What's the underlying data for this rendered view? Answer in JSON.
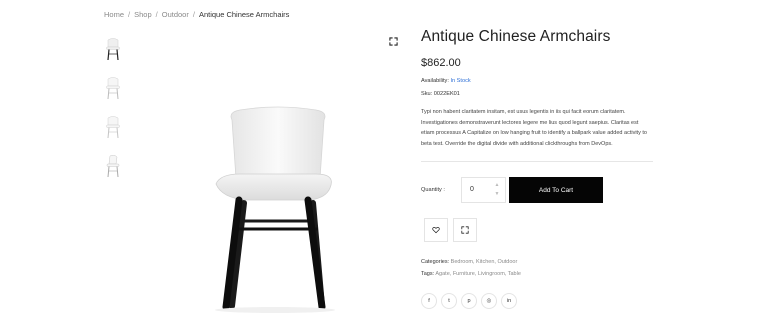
{
  "breadcrumb": {
    "items": [
      "Home",
      "Shop",
      "Outdoor"
    ],
    "separator": "/",
    "current": "Antique Chinese Armchairs"
  },
  "thumbnails": [
    {
      "icon": "chair-thumbnail-icon",
      "style": "dark legs"
    },
    {
      "icon": "chair-thumbnail-icon",
      "style": "light"
    },
    {
      "icon": "chair-thumbnail-icon",
      "style": "light"
    },
    {
      "icon": "chair-thumbnail-icon",
      "style": "light"
    }
  ],
  "product": {
    "title": "Antique Chinese Armchairs",
    "price": "$862.00",
    "availability_label": "Availability:",
    "availability_value": "In Stock",
    "sku_label": "Sku:",
    "sku_value": "0022EK01",
    "description": "Typi non habent claritatem insitam, est usus legentis in iis qui facit eorum claritatem. Investigationes demonstraverunt lectores legere me lius quod legunt saepius. Claritas est etiam processus A Capitalize on low hanging fruit to identify a ballpark value added activity to beta test. Override the digital divide with additional clickthroughs from DevOps."
  },
  "quantity": {
    "label": "Quantity :",
    "value": "0"
  },
  "cart": {
    "button_label": "Add To Cart"
  },
  "actions": {
    "wishlist_icon": "heart-icon",
    "compare_icon": "compare-icon"
  },
  "taxonomy": {
    "categories_label": "Categories:",
    "categories_value": "Bedroom, Kitchen, Outdoor",
    "tags_label": "Tags:",
    "tags_value": "Agate, Furniture, Livingroom, Table"
  },
  "social": [
    {
      "name": "facebook-icon",
      "glyph": "f"
    },
    {
      "name": "twitter-icon",
      "glyph": "t"
    },
    {
      "name": "pinterest-icon",
      "glyph": "p"
    },
    {
      "name": "dribbble-icon",
      "glyph": "◎"
    },
    {
      "name": "linkedin-icon",
      "glyph": "in"
    }
  ],
  "colors": {
    "accent_link": "#2d6fd6",
    "button_bg": "#050505",
    "button_text": "#ffffff",
    "chair_seat": "#f2f2f2",
    "chair_legs": "#111111"
  }
}
